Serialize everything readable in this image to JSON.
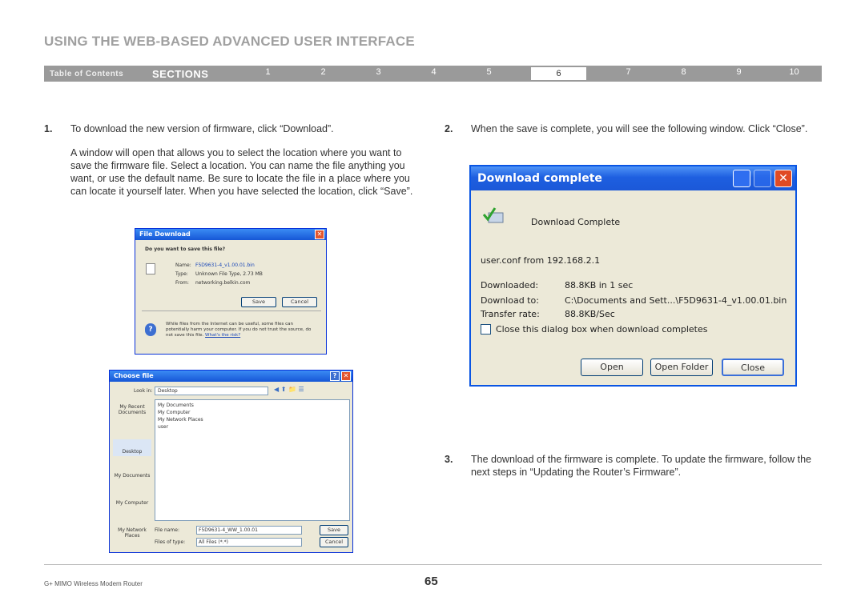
{
  "header": {
    "title": "USING THE WEB-BASED ADVANCED USER INTERFACE"
  },
  "nav": {
    "toc": "Table of Contents",
    "sections": "SECTIONS",
    "numbers": [
      "1",
      "2",
      "3",
      "4",
      "5",
      "6",
      "7",
      "8",
      "9",
      "10"
    ],
    "active": "6"
  },
  "steps": {
    "s1_num": "1.",
    "s1_text": "To download the new version of firmware, click “Download”.",
    "s1_para": "A window will open that allows you to select the location where you want to save the firmware file. Select a location. You can name the file anything you want, or use the default name. Be sure to locate the file in a place where you can locate it yourself later. When you have selected the location, click “Save”.",
    "s2_num": "2.",
    "s2_text": "When the save is complete, you will see the following window. Click “Close”.",
    "s3_num": "3.",
    "s3_text": "The download of the firmware is complete. To update the firmware, follow the next steps in “Updating the Router’s Firmware”."
  },
  "file_download": {
    "title": "File Download",
    "question": "Do you want to save this file?",
    "name_label": "Name:",
    "name_value": "F5D9631-4_v1.00.01.bin",
    "type_label": "Type:",
    "type_value": "Unknown File Type, 2.73 MB",
    "from_label": "From:",
    "from_value": "networking.belkin.com",
    "save": "Save",
    "cancel": "Cancel",
    "warning": "While files from the Internet can be useful, some files can potentially harm your computer. If you do not trust the source, do not save this file.",
    "risk_link": "What's the risk?"
  },
  "choose_file": {
    "title": "Choose file",
    "look_in_label": "Look in:",
    "look_in_value": "Desktop",
    "items": [
      "My Documents",
      "My Computer",
      "My Network Places",
      "user"
    ],
    "places": [
      "My Recent Documents",
      "Desktop",
      "My Documents",
      "My Computer",
      "My Network Places"
    ],
    "file_name_label": "File name:",
    "file_name_value": "F5D9631-4_WW_1.00.01",
    "file_type_label": "Files of type:",
    "file_type_value": "All Files (*.*)",
    "save": "Save",
    "cancel": "Cancel"
  },
  "download_complete": {
    "title": "Download complete",
    "heading": "Download Complete",
    "source": "user.conf from 192.168.2.1",
    "downloaded_label": "Downloaded:",
    "downloaded_value": "88.8KB in 1 sec",
    "download_to_label": "Download to:",
    "download_to_value": "C:\\Documents and Sett...\\F5D9631-4_v1.00.01.bin",
    "rate_label": "Transfer rate:",
    "rate_value": "88.8KB/Sec",
    "checkbox_label": "Close this dialog box when download completes",
    "open": "Open",
    "open_folder": "Open Folder",
    "close": "Close"
  },
  "footer": {
    "product": "G+ MIMO Wireless Modem Router",
    "page": "65"
  }
}
